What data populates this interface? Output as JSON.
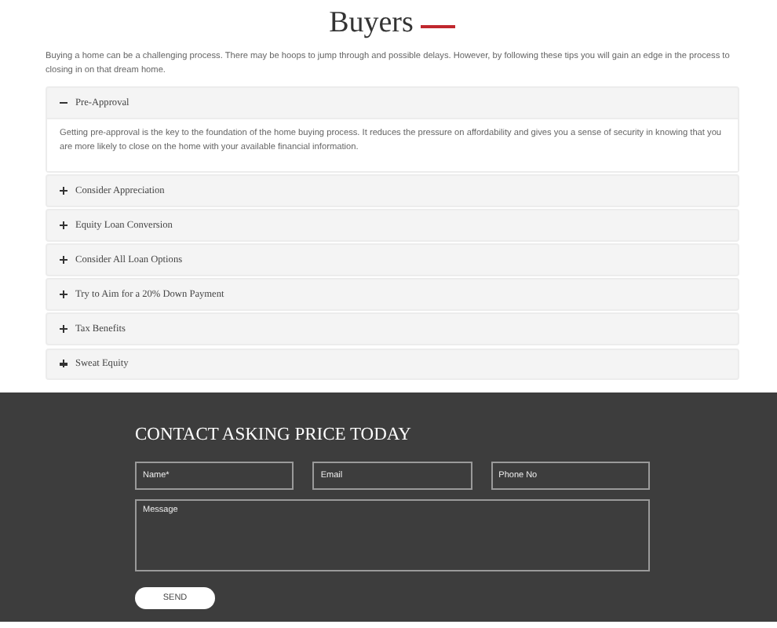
{
  "heading": "Buyers",
  "intro": "Buying a home can be a challenging process. There may be hoops to jump through and possible delays. However, by following these tips you will gain an edge in the process to closing in on that dream home.",
  "accordion": [
    {
      "title": "Pre-Approval",
      "expanded": true,
      "body": "Getting pre-approval is the key to the foundation of the home buying process. It reduces the pressure on affordability and gives you a sense of security in knowing that you are more likely to close on the home with your available financial information."
    },
    {
      "title": "Consider Appreciation",
      "expanded": false
    },
    {
      "title": "Equity Loan Conversion",
      "expanded": false
    },
    {
      "title": "Consider All Loan Options",
      "expanded": false
    },
    {
      "title": "Try to Aim for a 20% Down Payment",
      "expanded": false
    },
    {
      "title": "Tax Benefits",
      "expanded": false
    },
    {
      "title": "Sweat Equity",
      "expanded": false
    }
  ],
  "contact": {
    "title": "CONTACT ASKING PRICE TODAY",
    "fields": [
      {
        "placeholder": "Name*"
      },
      {
        "placeholder": "Email"
      },
      {
        "placeholder": "Phone No"
      }
    ],
    "message": {
      "placeholder": "Message"
    },
    "button": "SEND"
  }
}
